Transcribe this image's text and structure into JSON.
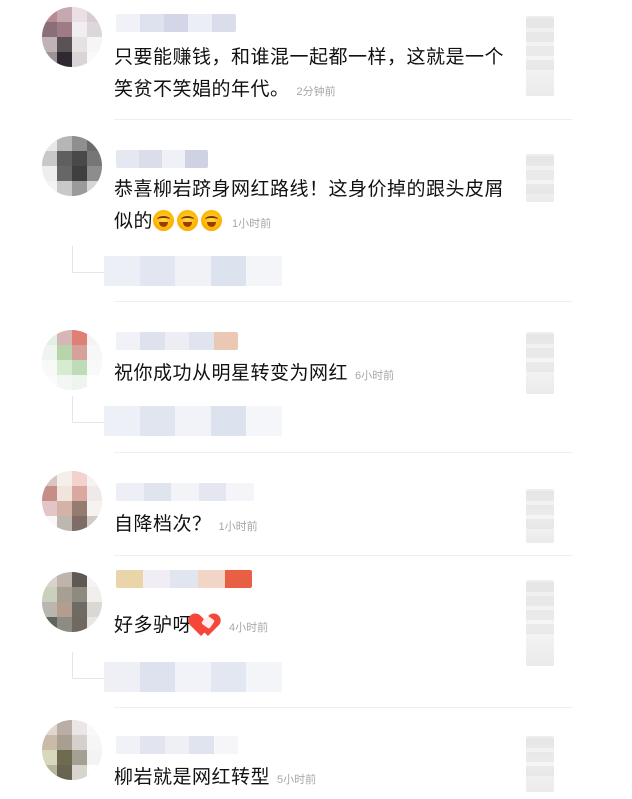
{
  "comments": [
    {
      "text_line1": "只要能赚钱，和谁混一起都一样，这就是一个",
      "text_line2": "笑贫不笑娼的年代。",
      "time": "2分钟前"
    },
    {
      "text_line1": "恭喜柳岩跻身网红路线！这身价掉的跟头皮屑",
      "text_line2": "似的",
      "time": "1小时前"
    },
    {
      "text_line1": "祝你成功从明星转变为网红",
      "time": "6小时前"
    },
    {
      "text_line1": "自降档次？",
      "time": "1小时前"
    },
    {
      "text_line1": "好多驴呀",
      "time": "4小时前"
    },
    {
      "text_line1": "柳岩就是网红转型",
      "time": "5小时前"
    }
  ],
  "icons": {
    "laugh_emoji": "laughing-face-icon",
    "heart_emoji": "heart-icon"
  }
}
